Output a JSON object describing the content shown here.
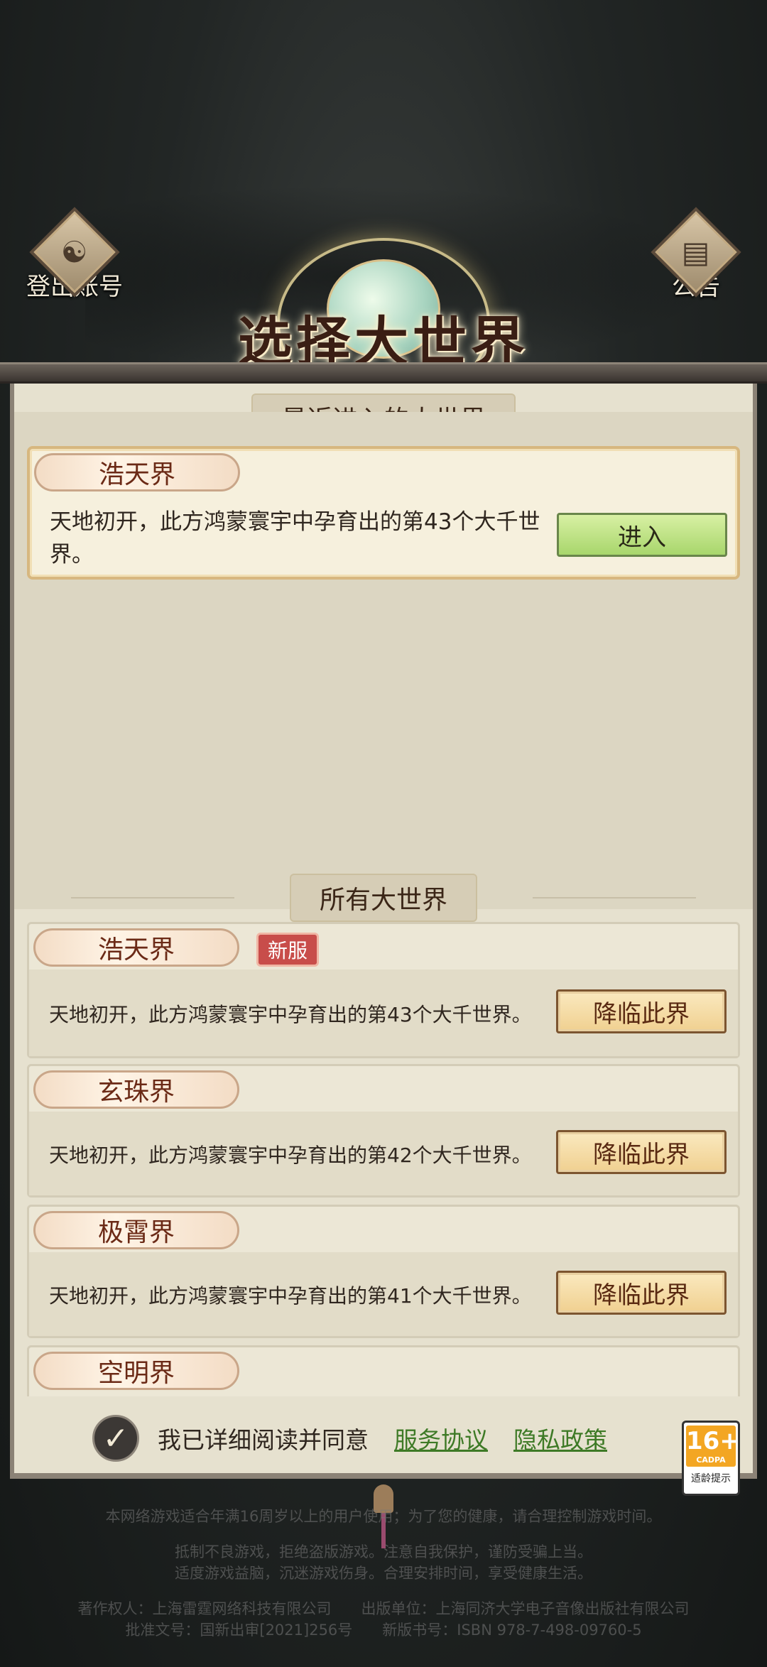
{
  "top": {
    "logout_label": "登出账号",
    "notice_label": "公告",
    "title": "选择大世界"
  },
  "recent": {
    "heading": "最近进入的大世界",
    "server": {
      "name": "浩天界",
      "description": "天地初开，此方鸿蒙寰宇中孕育出的第43个大千世界。",
      "button": "进入"
    }
  },
  "all": {
    "heading": "所有大世界",
    "servers": [
      {
        "name": "浩天界",
        "badge": "新服",
        "description": "天地初开，此方鸿蒙寰宇中孕育出的第43个大千世界。",
        "button": "降临此界"
      },
      {
        "name": "玄珠界",
        "description": "天地初开，此方鸿蒙寰宇中孕育出的第42个大千世界。",
        "button": "降临此界"
      },
      {
        "name": "极霄界",
        "description": "天地初开，此方鸿蒙寰宇中孕育出的第41个大千世界。",
        "button": "降临此界"
      },
      {
        "name": "空明界"
      }
    ]
  },
  "agreement": {
    "checked": true,
    "text": "我已详细阅读并同意",
    "service_link": "服务协议",
    "privacy_link": "隐私政策"
  },
  "age_rating": {
    "value": "16+",
    "org": "CADPA",
    "tip": "适龄提示"
  },
  "footer": {
    "line1": "本网络游戏适合年满16周岁以上的用户使用；为了您的健康，请合理控制游戏时间。",
    "line2": "抵制不良游戏，拒绝盗版游戏。注意自我保护，谨防受骗上当。",
    "line3": "适度游戏益脑，沉迷游戏伤身。合理安排时间，享受健康生活。",
    "line4": "著作权人：上海雷霆网络科技有限公司　　出版单位：上海同济大学电子音像出版社有限公司",
    "line5": "批准文号：国新出审[2021]256号　　新版书号：ISBN 978-7-498-09760-5"
  },
  "colors": {
    "panel_bg": "#e6e1cf",
    "enter_button": "#a8d66c",
    "descend_button": "#f0d090",
    "new_badge": "#c84d4a",
    "link": "#3e7a26"
  }
}
